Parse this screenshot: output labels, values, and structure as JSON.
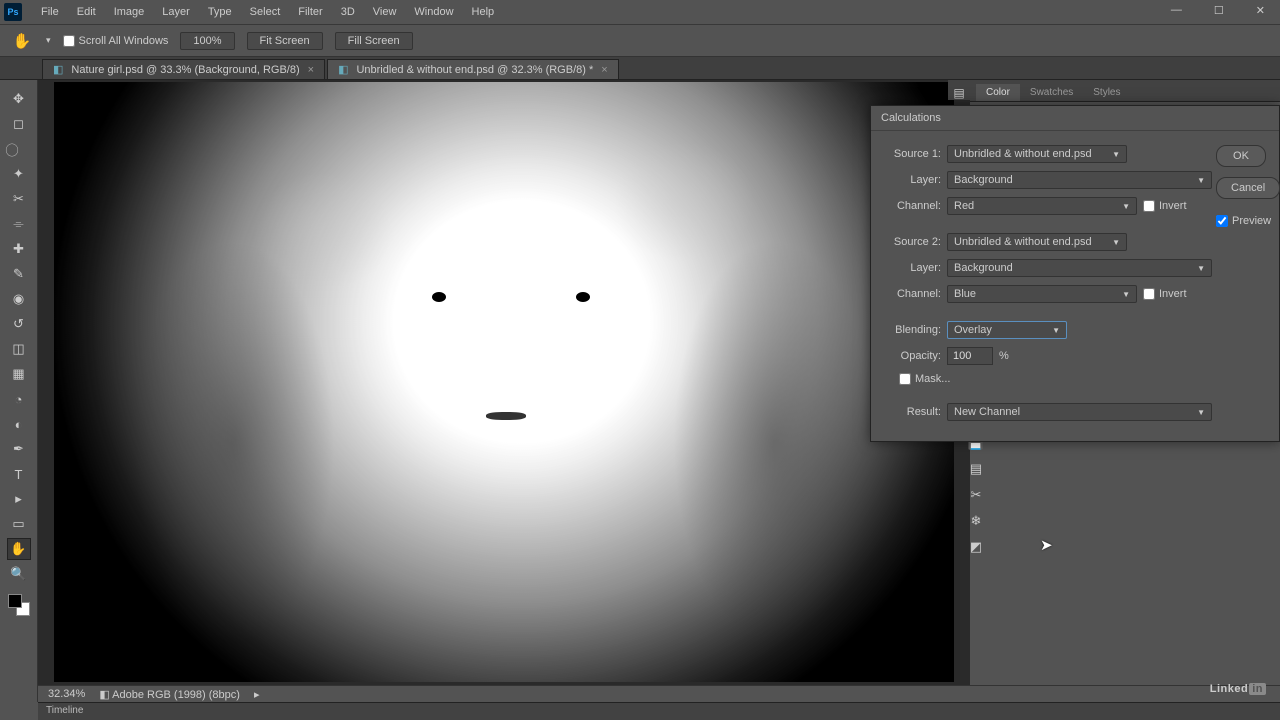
{
  "menubar": [
    "File",
    "Edit",
    "Image",
    "Layer",
    "Type",
    "Select",
    "Filter",
    "3D",
    "View",
    "Window",
    "Help"
  ],
  "optionsbar": {
    "scroll_all": "Scroll All Windows",
    "zoom": "100%",
    "fit": "Fit Screen",
    "fill": "Fill Screen"
  },
  "tabs": [
    {
      "label": "Nature girl.psd @ 33.3% (Background, RGB/8)"
    },
    {
      "label": "Unbridled & without end.psd @ 32.3% (RGB/8) *"
    }
  ],
  "panel_tabs": [
    "Color",
    "Swatches",
    "Styles"
  ],
  "dialog": {
    "title": "Calculations",
    "source1_label": "Source 1:",
    "source1": "Unbridled & without end.psd",
    "layer_label": "Layer:",
    "layer1": "Background",
    "channel_label": "Channel:",
    "channel1": "Red",
    "invert": "Invert",
    "source2_label": "Source 2:",
    "source2": "Unbridled & without end.psd",
    "layer2": "Background",
    "channel2": "Blue",
    "blending_label": "Blending:",
    "blending": "Overlay",
    "opacity_label": "Opacity:",
    "opacity": "100",
    "percent": "%",
    "mask": "Mask...",
    "result_label": "Result:",
    "result": "New Channel",
    "ok": "OK",
    "cancel": "Cancel",
    "preview": "Preview"
  },
  "status": {
    "zoom": "32.34%",
    "info": "Adobe RGB (1998) (8bpc)"
  },
  "timeline": "Timeline",
  "logo": "Ps",
  "brand": "Linked"
}
